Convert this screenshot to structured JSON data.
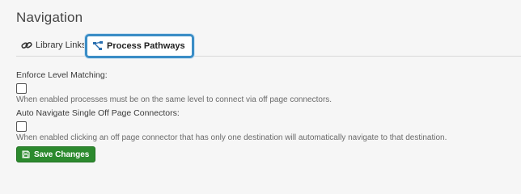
{
  "page": {
    "title": "Navigation"
  },
  "tabs": [
    {
      "label": "Library Links",
      "icon": "link-icon",
      "active": false
    },
    {
      "label": "Process Pathways",
      "icon": "process-flow-icon",
      "active": true
    }
  ],
  "settings": [
    {
      "label": "Enforce Level Matching:",
      "checked": false,
      "help": "When enabled processes must be on the same level to connect via off page connectors."
    },
    {
      "label": "Auto Navigate Single Off Page Connectors:",
      "checked": false,
      "help": "When enabled clicking an off page connector that has only one destination will automatically navigate to that destination."
    }
  ],
  "actions": {
    "save_label": "Save Changes",
    "save_icon": "save-icon"
  },
  "colors": {
    "active_tab_border": "#3a8dc6",
    "save_button": "#2c8a2e"
  }
}
